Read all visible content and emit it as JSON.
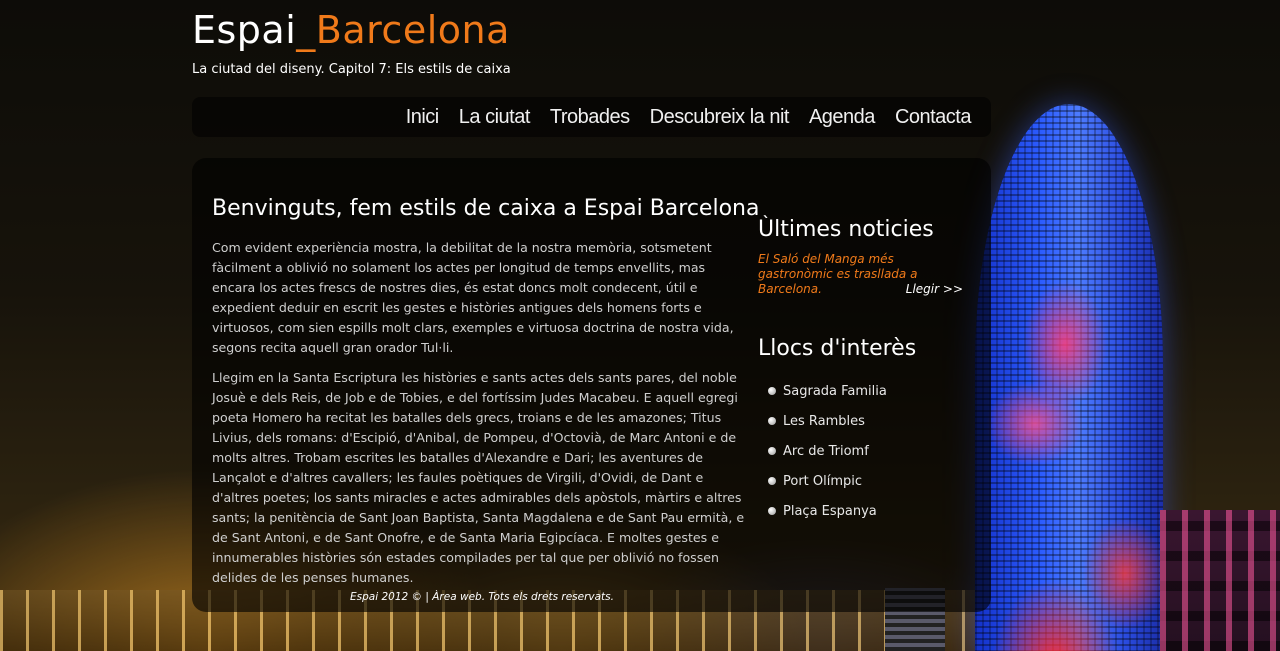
{
  "header": {
    "title_main": "Espai",
    "title_accent": "_Barcelona",
    "subtitle": "La ciutad del diseny. Capitol 7: Els estils de caixa"
  },
  "nav": {
    "items": [
      "Inici",
      "La ciutat",
      "Trobades",
      "Descubreix la nit",
      "Agenda",
      "Contacta"
    ]
  },
  "main": {
    "heading": "Benvinguts, fem estils de caixa a Espai Barcelona",
    "paragraphs": [
      "Com evident experiència mostra, la debilitat de la nostra memòria, sotsmetent fàcilment a oblivió no solament los actes per longitud de temps envellits, mas encara los actes frescs de nostres dies, és estat doncs molt condecent, útil e expedient deduir en escrit les gestes e històries antigues dels homens forts e virtuosos, com sien espills molt clars, exemples e virtuosa doctrina de nostra vida, segons recita aquell gran orador Tul·li.",
      "Llegim en la Santa Escriptura les històries e sants actes dels sants pares, del noble Josuè e dels Reis, de Job e de Tobies, e del fortíssim Judes Macabeu. E aquell egregi poeta Homero ha recitat les batalles dels grecs, troians e de les amazones; Titus Livius, dels romans: d'Escipió, d'Anibal, de Pompeu, d'Octovià, de Marc Antoni e de molts altres. Trobam escrites les batalles d'Alexandre e Dari; les aventures de Lançalot e d'altres cavallers; les faules poètiques de Virgili, d'Ovidi, de Dant e d'altres poetes; los sants miracles e actes admirables dels apòstols, màrtirs e altres sants; la penitència de Sant Joan Baptista, Santa Magdalena e de Sant Pau ermità, e de Sant Antoni, e de Sant Onofre, e de Santa Maria Egipcíaca. E moltes gestes e innumerables històries són estades compilades per tal que per oblivió no fossen delides de les penses humanes."
    ]
  },
  "sidebar": {
    "news_heading": "Ùltimes noticies",
    "news_item": "El Saló del Manga més gastronòmic es trasllada a Barcelona.",
    "read_more": "Llegir >>",
    "places_heading": "Llocs d'interès",
    "places": [
      "Sagrada Familia",
      "Les Rambles",
      "Arc de Triomf",
      "Port Olímpic",
      "Plaça Espanya"
    ]
  },
  "footer": {
    "text": "Espai 2012 © | Àrea web. Tots els drets reservats."
  },
  "colors": {
    "accent": "#f07a1a",
    "text": "#ffffff",
    "body_text": "#cfcfcf"
  }
}
